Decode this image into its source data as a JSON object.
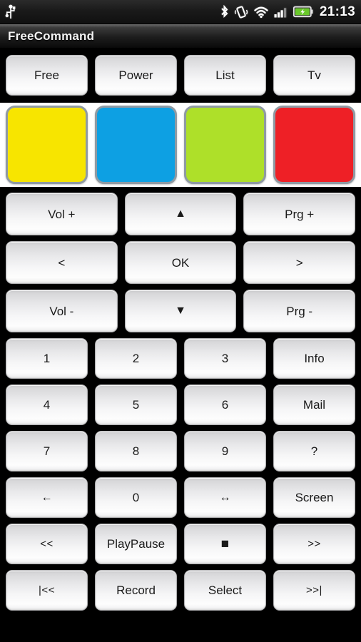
{
  "status_bar": {
    "usb_icon": "usb-icon",
    "bluetooth_icon": "bluetooth-icon",
    "vibrate_icon": "vibrate-icon",
    "wifi_icon": "wifi-icon",
    "signal_icon": "cellular-signal-icon",
    "battery_icon": "battery-charging-icon",
    "time": "21:13"
  },
  "title_bar": {
    "app_title": "FreeCommand"
  },
  "top_row": {
    "buttons": [
      {
        "label": "Free",
        "name": "free-button"
      },
      {
        "label": "Power",
        "name": "power-button"
      },
      {
        "label": "List",
        "name": "list-button"
      },
      {
        "label": "Tv",
        "name": "tv-button"
      }
    ]
  },
  "color_row": {
    "buttons": [
      {
        "name": "yellow-color-button",
        "color": "#F7E500",
        "label": ""
      },
      {
        "name": "blue-color-button",
        "color": "#0DA0E3",
        "label": ""
      },
      {
        "name": "green-color-button",
        "color": "#AEE029",
        "label": ""
      },
      {
        "name": "red-color-button",
        "color": "#EE2026",
        "label": ""
      }
    ]
  },
  "nav_rows": [
    {
      "buttons": [
        {
          "label": "Vol +",
          "name": "volume-up-button"
        },
        {
          "label": "▲",
          "name": "dpad-up-button"
        },
        {
          "label": "Prg +",
          "name": "program-up-button"
        }
      ]
    },
    {
      "buttons": [
        {
          "label": "<",
          "name": "dpad-left-button"
        },
        {
          "label": "OK",
          "name": "ok-button"
        },
        {
          "label": ">",
          "name": "dpad-right-button"
        }
      ]
    },
    {
      "buttons": [
        {
          "label": "Vol -",
          "name": "volume-down-button"
        },
        {
          "label": "▼",
          "name": "dpad-down-button"
        },
        {
          "label": "Prg -",
          "name": "program-down-button"
        }
      ]
    }
  ],
  "pad_rows": [
    {
      "buttons": [
        {
          "label": "1",
          "name": "digit-1-button"
        },
        {
          "label": "2",
          "name": "digit-2-button"
        },
        {
          "label": "3",
          "name": "digit-3-button"
        },
        {
          "label": "Info",
          "name": "info-button"
        }
      ]
    },
    {
      "buttons": [
        {
          "label": "4",
          "name": "digit-4-button"
        },
        {
          "label": "5",
          "name": "digit-5-button"
        },
        {
          "label": "6",
          "name": "digit-6-button"
        },
        {
          "label": "Mail",
          "name": "mail-button"
        }
      ]
    },
    {
      "buttons": [
        {
          "label": "7",
          "name": "digit-7-button"
        },
        {
          "label": "8",
          "name": "digit-8-button"
        },
        {
          "label": "9",
          "name": "digit-9-button"
        },
        {
          "label": "?",
          "name": "help-button"
        }
      ]
    },
    {
      "buttons": [
        {
          "label": "←",
          "name": "back-button"
        },
        {
          "label": "0",
          "name": "digit-0-button"
        },
        {
          "label": "↔",
          "name": "swap-button"
        },
        {
          "label": "Screen",
          "name": "screen-button"
        }
      ]
    },
    {
      "buttons": [
        {
          "label": "<<",
          "name": "rewind-button"
        },
        {
          "label": "PlayPause",
          "name": "play-pause-button"
        },
        {
          "label": "■",
          "name": "stop-button"
        },
        {
          "label": ">>",
          "name": "fast-forward-button"
        }
      ]
    },
    {
      "buttons": [
        {
          "label": "|<<",
          "name": "previous-track-button"
        },
        {
          "label": "Record",
          "name": "record-button"
        },
        {
          "label": "Select",
          "name": "select-button"
        },
        {
          "label": ">>|",
          "name": "next-track-button"
        }
      ]
    }
  ]
}
